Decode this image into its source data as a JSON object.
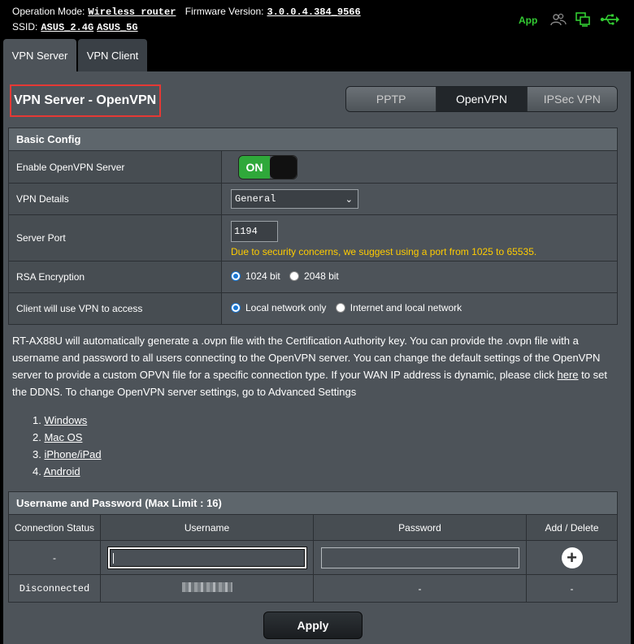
{
  "status_bar": {
    "operation_mode_label": "Operation Mode:",
    "operation_mode_value": "Wireless router",
    "firmware_label": "Firmware Version:",
    "firmware_value": "3.0.0.4.384_9566",
    "ssid_label": "SSID:",
    "ssid_values": [
      "ASUS_2.4G",
      "ASUS_5G"
    ],
    "app_label": "App",
    "icons": [
      "users-icon",
      "network-icon",
      "usb-icon"
    ],
    "accent_color": "#33cc33"
  },
  "tabs": [
    {
      "label": "VPN Server",
      "active": true
    },
    {
      "label": "VPN Client",
      "active": false
    }
  ],
  "page": {
    "title": "VPN Server - OpenVPN",
    "title_highlight_color": "#e53935"
  },
  "protocol_tabs": [
    {
      "label": "PPTP",
      "selected": false
    },
    {
      "label": "OpenVPN",
      "selected": true
    },
    {
      "label": "IPSec VPN",
      "selected": false
    }
  ],
  "basic_config": {
    "header": "Basic Config",
    "enable_label": "Enable OpenVPN Server",
    "enable_value": "ON",
    "details_label": "VPN Details",
    "details_value": "General",
    "port_label": "Server Port",
    "port_value": "1194",
    "port_hint": "Due to security concerns, we suggest using a port from 1025 to 65535.",
    "rsa_label": "RSA Encryption",
    "rsa_options": [
      {
        "label": "1024 bit",
        "checked": true
      },
      {
        "label": "2048 bit",
        "checked": false
      }
    ],
    "access_label": "Client will use VPN to access",
    "access_options": [
      {
        "label": "Local network only",
        "checked": true
      },
      {
        "label": "Internet and local network",
        "checked": false
      }
    ]
  },
  "description": {
    "text_before_link": "RT-AX88U will automatically generate a .ovpn file with the Certification Authority key. You can provide the .ovpn file with a username and password to all users connecting to the OpenVPN server. You can change the default settings of the OpenVPN server to provide a custom OPVN file for a specific connection type. If your WAN IP address is dynamic, please click",
    "link_text": "here",
    "text_after_link": "to set the DDNS. To change OpenVPN server settings, go to Advanced Settings"
  },
  "os_guides": [
    {
      "num": "1.",
      "label": "Windows"
    },
    {
      "num": "2.",
      "label": "Mac OS"
    },
    {
      "num": "3.",
      "label": "iPhone/iPad"
    },
    {
      "num": "4.",
      "label": "Android"
    }
  ],
  "users": {
    "header": "Username and Password (Max Limit : 16)",
    "columns": [
      "Connection Status",
      "Username",
      "Password",
      "Add / Delete"
    ],
    "input_row_status": "-",
    "rows": [
      {
        "status": "Disconnected",
        "username": "",
        "password": "-",
        "action": "-"
      }
    ]
  },
  "apply_label": "Apply"
}
